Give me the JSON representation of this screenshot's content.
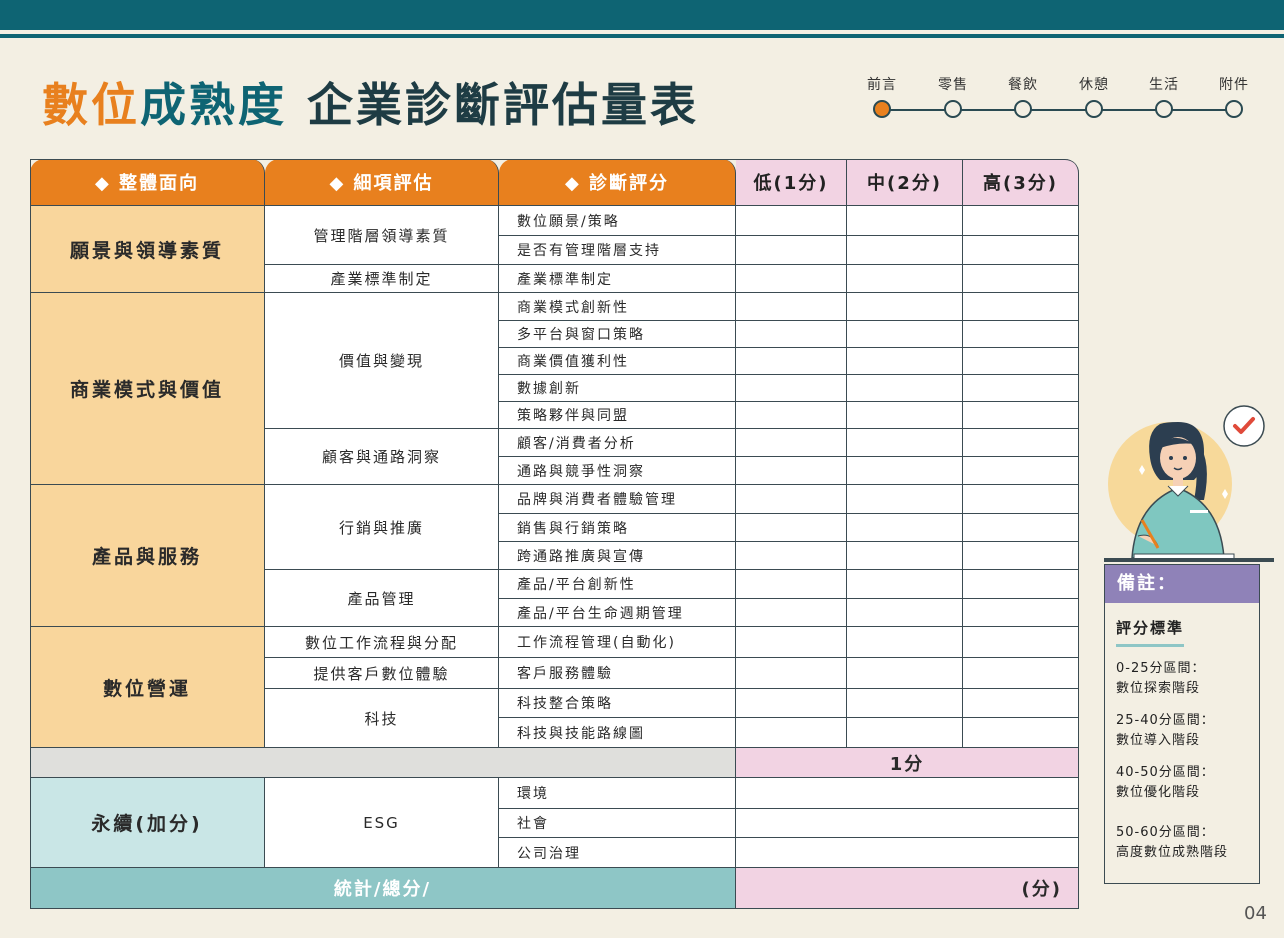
{
  "title": {
    "part1": "數位",
    "part2": "成熟度",
    "part3": "企業診斷評估量表"
  },
  "steps": [
    "前言",
    "零售",
    "餐飲",
    "休憩",
    "生活",
    "附件"
  ],
  "headers": {
    "aspect": "◆ 整體面向",
    "detail": "◆ 細項評估",
    "diagnosis": "◆ 診斷評分",
    "low": "低(1分)",
    "mid": "中(2分)",
    "high": "高(3分)"
  },
  "categories": {
    "vision": "願景與領導素質",
    "business": "商業模式與價值",
    "product": "產品與服務",
    "operations": "數位營運",
    "sustain": "永續(加分)"
  },
  "details": {
    "mgmt_quality": "管理階層領導素質",
    "industry_std": "產業標準制定",
    "value": "價值與變現",
    "customer_insight": "顧客與通路洞察",
    "marketing": "行銷與推廣",
    "product_mgmt": "產品管理",
    "workflow": "數位工作流程與分配",
    "cx": "提供客戶數位體驗",
    "tech": "科技",
    "esg": "ESG"
  },
  "items": [
    "數位願景/策略",
    "是否有管理階層支持",
    "產業標準制定",
    "商業模式創新性",
    "多平台與窗口策略",
    "商業價值獲利性",
    "數據創新",
    "策略夥伴與同盟",
    "顧客/消費者分析",
    "通路與競爭性洞察",
    "品牌與消費者體驗管理",
    "銷售與行銷策略",
    "跨通路推廣與宣傳",
    "產品/平台創新性",
    "產品/平台生命週期管理",
    "工作流程管理(自動化)",
    "客戶服務體驗",
    "科技整合策略",
    "科技與技能路線圖",
    "環境",
    "社會",
    "公司治理"
  ],
  "bonus_label": "1分",
  "total": {
    "label": "統計/總分/",
    "unit": "(分)"
  },
  "notes": {
    "heading": "備註：",
    "subheading": "評分標準",
    "ranges": [
      {
        "range": "0-25分區間：",
        "stage": "數位探索階段"
      },
      {
        "range": "25-40分區間：",
        "stage": "數位導入階段"
      },
      {
        "range": "40-50分區間：",
        "stage": "數位優化階段"
      },
      {
        "range": "50-60分區間：",
        "stage": "高度數位成熟階段"
      }
    ]
  },
  "page_number": "04",
  "colors": {
    "teal": "#0e6473",
    "orange": "#e8801e",
    "peach": "#f9d69c",
    "pink": "#f2d3e3",
    "lightteal": "#8ec6c6",
    "purple": "#8f82b8"
  }
}
